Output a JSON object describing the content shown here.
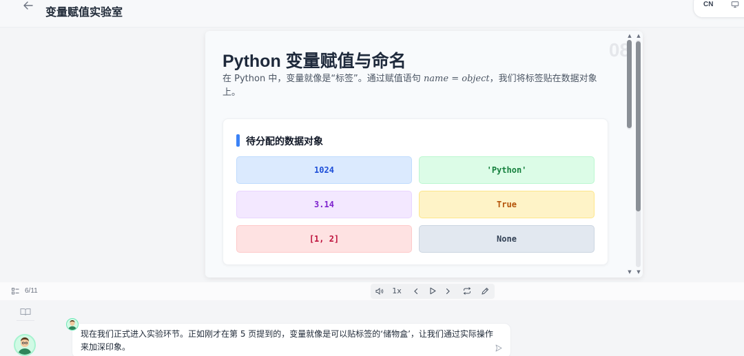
{
  "header": {
    "back_icon": "arrow-left-icon",
    "title": "变量赋值实验室",
    "lang_label": "CN",
    "display_icon": "monitor-icon"
  },
  "slide": {
    "page_watermark": "08",
    "title": "Python 变量赋值与命名",
    "desc_before": "在 Python 中，变量就像是“标签”。通过赋值语句 ",
    "desc_math": "name = object",
    "desc_after": "，我们将标签贴在数据对象上。",
    "panel_title": "待分配的数据对象",
    "objects": [
      {
        "label": "1024",
        "bg": "#dbeafe",
        "border": "#bfdbfe",
        "color": "#1d4ed8"
      },
      {
        "label": "'Python'",
        "bg": "#dcfce7",
        "border": "#bbf7d0",
        "color": "#15803d"
      },
      {
        "label": "3.14",
        "bg": "#f3e8ff",
        "border": "#e9d5ff",
        "color": "#7e22ce"
      },
      {
        "label": "True",
        "bg": "#fef3c7",
        "border": "#fde68a",
        "color": "#b45309"
      },
      {
        "label": "[1, 2]",
        "bg": "#fee2e2",
        "border": "#fecaca",
        "color": "#be123c"
      },
      {
        "label": "None",
        "bg": "#e2e8f0",
        "border": "#cbd5e1",
        "color": "#334155"
      }
    ]
  },
  "toolbar": {
    "progress_icon": "list-icon",
    "progress": "6/11",
    "volume_icon": "volume-icon",
    "speed": "1x",
    "prev_icon": "chevron-left-icon",
    "play_icon": "play-icon",
    "next_icon": "chevron-right-icon",
    "loop_icon": "repeat-icon",
    "edit_icon": "pencil-icon"
  },
  "chat": {
    "book_icon": "book-icon",
    "message": "现在我们正式进入实验环节。正如刚才在第 5 页提到的，变量就像是可以贴标签的‘储物盒’，让我们通过实际操作来加深印象。",
    "send_icon": "send-icon"
  },
  "colors": {
    "accent": "#3b82f6",
    "background": "#f4f5f7"
  }
}
